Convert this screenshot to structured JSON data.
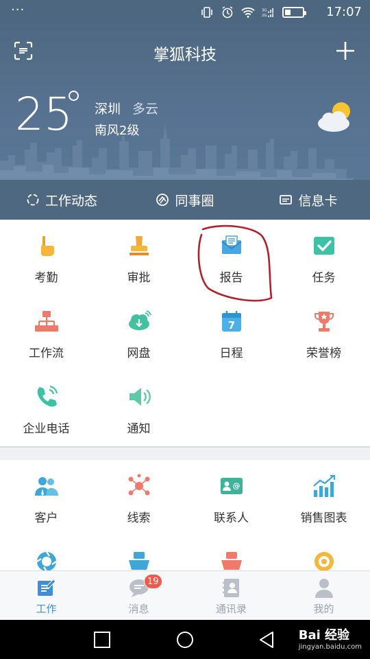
{
  "status_bar": {
    "dots": "···",
    "network": "3G 2G",
    "time": "17:07"
  },
  "header": {
    "title": "掌狐科技",
    "scan_icon": "scan-icon",
    "add_icon": "plus-icon"
  },
  "weather": {
    "temperature": "25",
    "city": "深圳",
    "condition": "多云",
    "wind": "南风2级",
    "icon": "partly-cloudy-icon"
  },
  "tabs": [
    {
      "label": "工作动态",
      "icon": "activity-icon"
    },
    {
      "label": "同事圈",
      "icon": "circle-icon"
    },
    {
      "label": "信息卡",
      "icon": "card-icon"
    }
  ],
  "apps_primary": [
    {
      "label": "考勤",
      "icon": "hand-icon",
      "color": "#f4b63b"
    },
    {
      "label": "审批",
      "icon": "stamp-icon",
      "color": "#f0a93a"
    },
    {
      "label": "报告",
      "icon": "report-icon",
      "color": "#4aa6e0"
    },
    {
      "label": "任务",
      "icon": "task-icon",
      "color": "#3cc2a4"
    },
    {
      "label": "工作流",
      "icon": "workflow-icon",
      "color": "#f07a6a"
    },
    {
      "label": "网盘",
      "icon": "cloud-drive-icon",
      "color": "#43c0a0"
    },
    {
      "label": "日程",
      "icon": "calendar-icon",
      "color": "#4ab0e6"
    },
    {
      "label": "荣誉榜",
      "icon": "trophy-icon",
      "color": "#f07a6a"
    },
    {
      "label": "企业电话",
      "icon": "phone-icon",
      "color": "#3cc2a4"
    },
    {
      "label": "通知",
      "icon": "speaker-icon",
      "color": "#5ec9a7"
    }
  ],
  "apps_secondary": [
    {
      "label": "客户",
      "icon": "customer-icon",
      "color": "#3ea7d8"
    },
    {
      "label": "线索",
      "icon": "clue-icon",
      "color": "#f07a6a"
    },
    {
      "label": "联系人",
      "icon": "contact-icon",
      "color": "#3cb39a"
    },
    {
      "label": "销售图表",
      "icon": "sales-chart-icon",
      "color": "#3ea7d8"
    },
    {
      "label": "",
      "icon": "cycle-icon",
      "color": "#3ea7d8"
    },
    {
      "label": "",
      "icon": "ship-icon",
      "color": "#3ea7d8"
    },
    {
      "label": "",
      "icon": "ship-red-icon",
      "color": "#f07a6a"
    },
    {
      "label": "",
      "icon": "target-icon",
      "color": "#f4b63b"
    }
  ],
  "bottom_nav": [
    {
      "label": "工作",
      "icon": "work-icon",
      "active": true
    },
    {
      "label": "消息",
      "icon": "message-icon",
      "badge": "19"
    },
    {
      "label": "通讯录",
      "icon": "address-book-icon"
    },
    {
      "label": "我的",
      "icon": "profile-icon"
    }
  ],
  "watermark": {
    "brand": "Bai 经验",
    "url": "jingyan.baidu.com"
  },
  "colors": {
    "header_bg": "#4f6882",
    "active_nav": "#3f8fd6",
    "badge": "#f05a4e",
    "annotation": "#b3202a"
  }
}
